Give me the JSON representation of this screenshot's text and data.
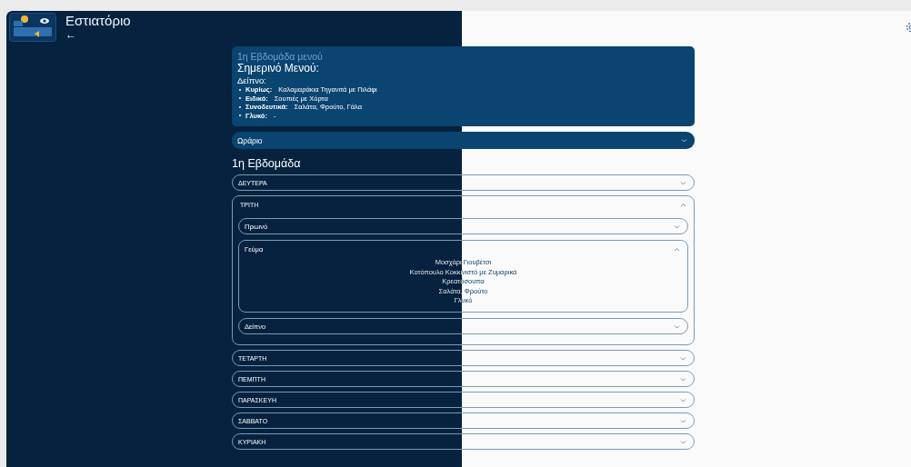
{
  "header": {
    "title": "Εστιατόριο",
    "back": "←"
  },
  "menu_card": {
    "week_label": "1η Εβδομάδα μενού",
    "heading": "Σημερινό Μενού:",
    "meal_title": "Δείπνο:",
    "items": [
      {
        "label": "Κυρίως:",
        "value": "Καλαμαράκια Τηγανιτά με Πιλάφι"
      },
      {
        "label": "Ειδικό:",
        "value": "Σουπιές με Χόρτα"
      },
      {
        "label": "Συνοδευτικά:",
        "value": "Σαλάτα, Φρούτο, Γάλα"
      },
      {
        "label": "Γλυκό:",
        "value": "-"
      }
    ]
  },
  "schedule": {
    "label": "Ωράριο",
    "expanded": false
  },
  "week": {
    "heading": "1η Εβδομάδα",
    "days": [
      {
        "label": "ΔΕΥΤΕΡΑ",
        "expanded": false
      },
      {
        "label": "ΤΡΙΤΗ",
        "expanded": true,
        "meals": [
          {
            "label": "Πρωινό",
            "expanded": false
          },
          {
            "label": "Γεύμα",
            "expanded": true,
            "items": [
              "Μοσχάρι Γιουβέτσι",
              "Κοτόπουλο Κοκκινιστό με Ζυμαρικά",
              "Κρεατόσουπα",
              "Σαλάτα, Φρούτο",
              "Γλυκό"
            ]
          },
          {
            "label": "Δείπνο",
            "expanded": false
          }
        ]
      },
      {
        "label": "ΤΕΤΑΡΤΗ",
        "expanded": false
      },
      {
        "label": "ΠΕΜΠΤΗ",
        "expanded": false
      },
      {
        "label": "ΠΑΡΑΣΚΕΥΗ",
        "expanded": false
      },
      {
        "label": "ΣΑΒΒΑΤΟ",
        "expanded": false
      },
      {
        "label": "ΚΥΡΙΑΚΗ",
        "expanded": false
      }
    ]
  }
}
